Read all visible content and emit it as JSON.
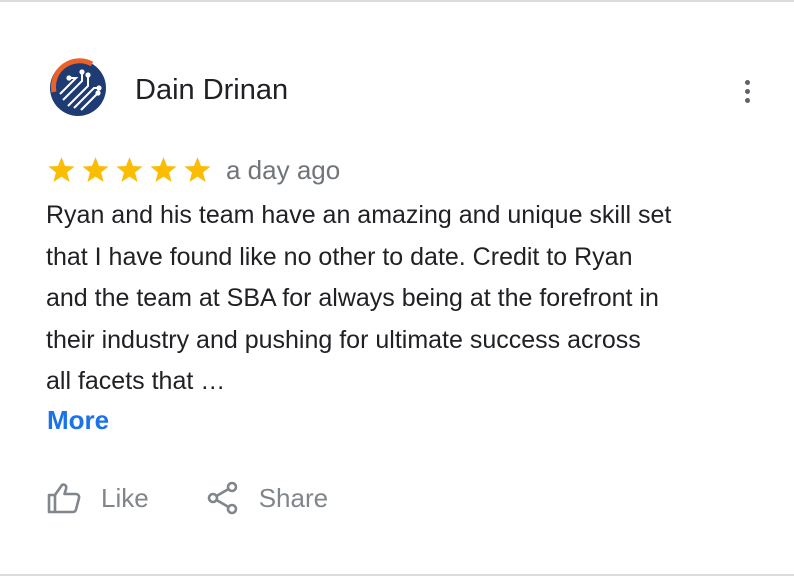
{
  "review": {
    "author": "Dain Drinan",
    "avatar_icon": "circuit-logo-icon",
    "rating": 5,
    "rating_max": 5,
    "time": "a day ago",
    "text": "Ryan and his team have an amazing and unique skill set\nthat I have found like no other to date. Credit to Ryan\nand the team at SBA for always being at the forefront in\ntheir industry and pushing for ultimate success across\nall facets that …",
    "more_label": "More"
  },
  "actions": {
    "like_label": "Like",
    "share_label": "Share"
  },
  "colors": {
    "star": "#fbbc04",
    "link": "#1a73e8",
    "muted": "#70757a",
    "text": "#202124",
    "avatar_ring": "#e8622a",
    "avatar_bg": "#1f3b73"
  },
  "icons": {
    "menu": "more-vert-icon",
    "like": "thumb-up-icon",
    "share": "share-icon",
    "star": "star-icon"
  }
}
